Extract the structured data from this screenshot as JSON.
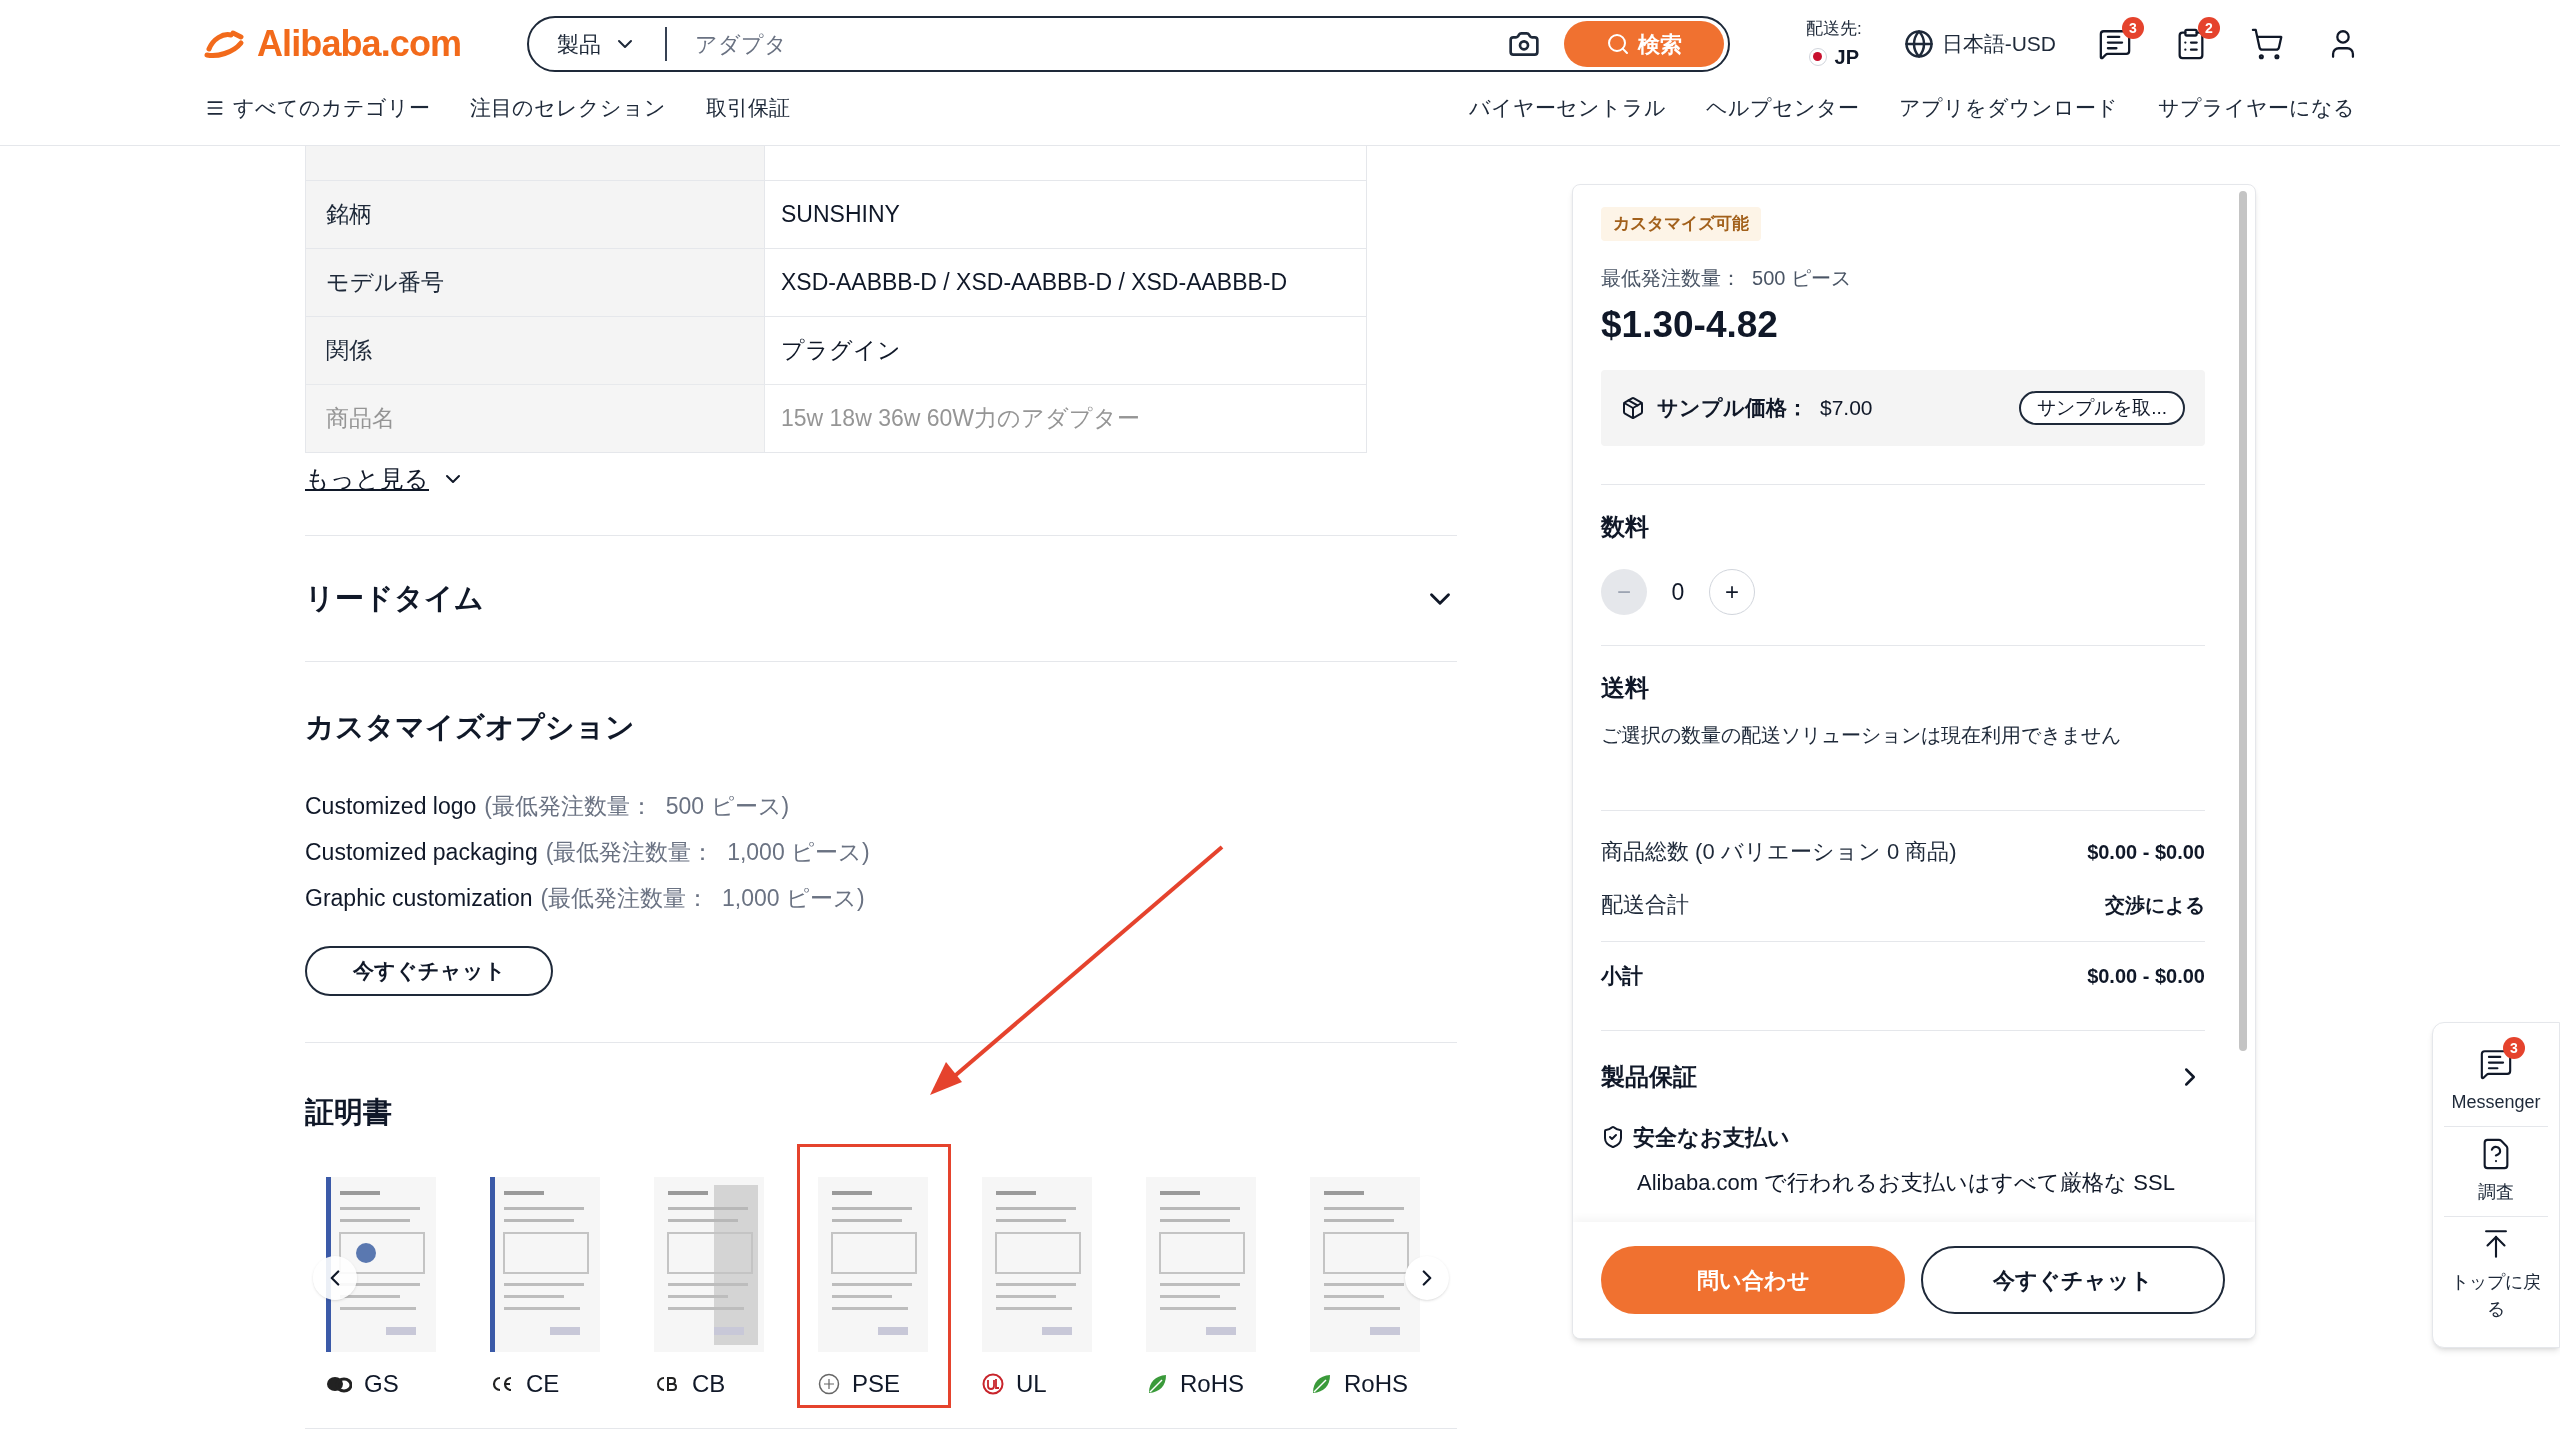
{
  "header": {
    "logo": "Alibaba.com",
    "search": {
      "category": "製品",
      "placeholder": "アダプタ",
      "button": "検索"
    },
    "ship_to": {
      "label": "配送先:",
      "country": "JP"
    },
    "language": "日本語-USD",
    "messages_badge": "3",
    "orders_badge": "2"
  },
  "nav": {
    "left": [
      "すべてのカテゴリー",
      "注目のセレクション",
      "取引保証"
    ],
    "right": [
      "バイヤーセントラル",
      "ヘルプセンター",
      "アプリをダウンロード",
      "サプライヤーになる"
    ]
  },
  "attributes": [
    {
      "label": "銘柄",
      "value": "SUNSHINY",
      "faded": false
    },
    {
      "label": "モデル番号",
      "value": "XSD-AABBB-D / XSD-AABBB-D / XSD-AABBB-D",
      "faded": false
    },
    {
      "label": "関係",
      "value": "プラグイン",
      "faded": false
    },
    {
      "label": "商品名",
      "value": "15w 18w 36w 60W力のアダプター",
      "faded": true
    }
  ],
  "more_link": "もっと見る",
  "lead_time": {
    "title": "リードタイム",
    "expanded": false
  },
  "customization": {
    "title": "カスタマイズオプション",
    "options": [
      {
        "name": "Customized logo",
        "moq": "(最低発注数量：  500 ピース)"
      },
      {
        "name": "Customized packaging",
        "moq": "(最低発注数量：  1,000 ピース)"
      },
      {
        "name": "Graphic customization",
        "moq": "(最低発注数量：  1,000 ピース)"
      }
    ],
    "chat_button": "今すぐチャット"
  },
  "certificates": {
    "title": "証明書",
    "items": [
      {
        "kind": "gs",
        "label": "GS",
        "selected": false
      },
      {
        "kind": "ce",
        "label": "CE",
        "selected": false
      },
      {
        "kind": "cb",
        "label": "CB",
        "selected": false
      },
      {
        "kind": "pse",
        "label": "PSE",
        "selected": true
      },
      {
        "kind": "ul",
        "label": "UL",
        "selected": false
      },
      {
        "kind": "rohs",
        "label": "RoHS",
        "selected": false
      },
      {
        "kind": "rohs",
        "label": "RoHS",
        "selected": false
      }
    ]
  },
  "order_panel": {
    "badge": "カスタマイズ可能",
    "moq": "最低発注数量：  500 ピース",
    "price": "$1.30-4.82",
    "sample": {
      "label": "サンプル価格：",
      "price": "$7.00",
      "button": "サンプルを取..."
    },
    "quantity": {
      "title": "数料",
      "value": "0",
      "minus": "−",
      "plus": "+",
      "minus_disabled": true
    },
    "shipping": {
      "title": "送料",
      "note": "ご選択の数量の配送ソリューションは現在利用できません"
    },
    "summary": [
      {
        "label": "商品総数 (0 バリエーション 0 商品)",
        "value": "$0.00 - $0.00"
      },
      {
        "label": "配送合計",
        "value": "交渉による"
      }
    ],
    "subtotal": {
      "label": "小計",
      "value": "$0.00 - $0.00"
    },
    "guarantee": "製品保証",
    "secure_payment": {
      "title": "安全なお支払い",
      "text": "Alibaba.com で行われるお支払いはすべて厳格な SSL"
    },
    "buttons": {
      "inquiry": "問い合わせ",
      "chat": "今すぐチャット"
    }
  },
  "side_tools": [
    {
      "kind": "messenger",
      "label": "Messenger",
      "badge": "3"
    },
    {
      "kind": "survey",
      "label": "調査"
    },
    {
      "kind": "top",
      "label": "トップに戻る"
    }
  ]
}
